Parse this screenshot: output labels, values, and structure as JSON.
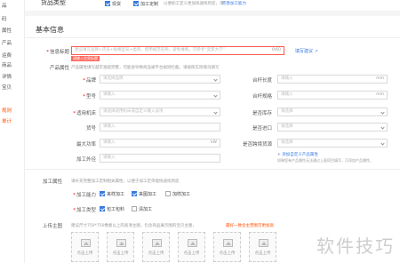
{
  "sidebar": {
    "items": [
      {
        "label": "品",
        "active": false
      },
      {
        "label": "码",
        "active": false
      },
      {
        "label": "属性",
        "active": false
      },
      {
        "label": "产品",
        "active": false
      },
      {
        "label": "运费",
        "active": false
      },
      {
        "label": "商品",
        "active": false
      },
      {
        "label": "详情",
        "active": false
      },
      {
        "label": "宝贝",
        "active": false
      },
      {
        "label": "规则",
        "active": true
      },
      {
        "label": "单计",
        "active": true
      }
    ]
  },
  "goods_type": {
    "label": "货品类型",
    "opt1": "现货",
    "opt2": "加工定制",
    "hint": "以便如工定义更加快速找到您，请",
    "link": "完善加工能力"
  },
  "basic": {
    "title": "基本信息",
    "title_label": "信息标题",
    "title_placeholder": "建议填写品牌+货号+规格型号+类目，使用规范名称，避免堆砌。可参考“卖家大学”",
    "title_count": "0/60",
    "title_tip": "请输入信息标题",
    "rules_link": "填写建议"
  },
  "props": {
    "label": "产品属性",
    "hint": "产品属性填写越丰富越完整，可能会导致商品被平台规则拦截，请按照实际情况填写",
    "left": [
      {
        "label": "品牌",
        "required": true,
        "placeholder": "请选择品牌",
        "type": "select"
      },
      {
        "label": "型号",
        "required": true,
        "placeholder": "请输入",
        "type": "select"
      },
      {
        "label": "适用机床",
        "required": true,
        "placeholder": "请选择适用机床或自定义输入该项",
        "type": "select"
      },
      {
        "label": "货号",
        "required": false,
        "placeholder": "请输入",
        "type": "text"
      },
      {
        "label": "最大功率",
        "required": false,
        "placeholder": "请输入",
        "suffix": "kW",
        "type": "text"
      },
      {
        "label": "加工外径",
        "required": false,
        "placeholder": "请输入",
        "type": "text"
      }
    ],
    "right": [
      {
        "label": "台杆长度",
        "placeholder": "请输入",
        "suffix": "mm"
      },
      {
        "label": "台杆规格",
        "placeholder": "请输入",
        "suffix": "mm"
      },
      {
        "label": "是否库存",
        "placeholder": "请选择",
        "select": true
      },
      {
        "label": "是否进口",
        "placeholder": "请选择",
        "select": true
      },
      {
        "label": "是否跨境货源",
        "placeholder": "请选择",
        "select": true
      }
    ],
    "add_link": "+ 添加自定义产品属性",
    "add_hint": "如果您有产品属性无法通过上面项目填写，可添加产品属性。"
  },
  "process": {
    "label": "加工属性",
    "hint": "请补充完整加工定制相关属性，以便于加工定单能快速找到您",
    "ability_label": "加工能力",
    "ability_opts": [
      "来样加工",
      "来图加工",
      "加样加工"
    ],
    "type_label": "加工类型",
    "type_opts": [
      "包工包料",
      "清加工"
    ]
  },
  "upload": {
    "label": "上传主图",
    "hint": "建议尺寸750*750像素以上的高清主图，包含商品展示图的宝贝主图，",
    "hint2": "最好一致含主营图可更加高",
    "slot_caption": "点击上传",
    "slots": 6
  },
  "watermark": "软件技巧"
}
